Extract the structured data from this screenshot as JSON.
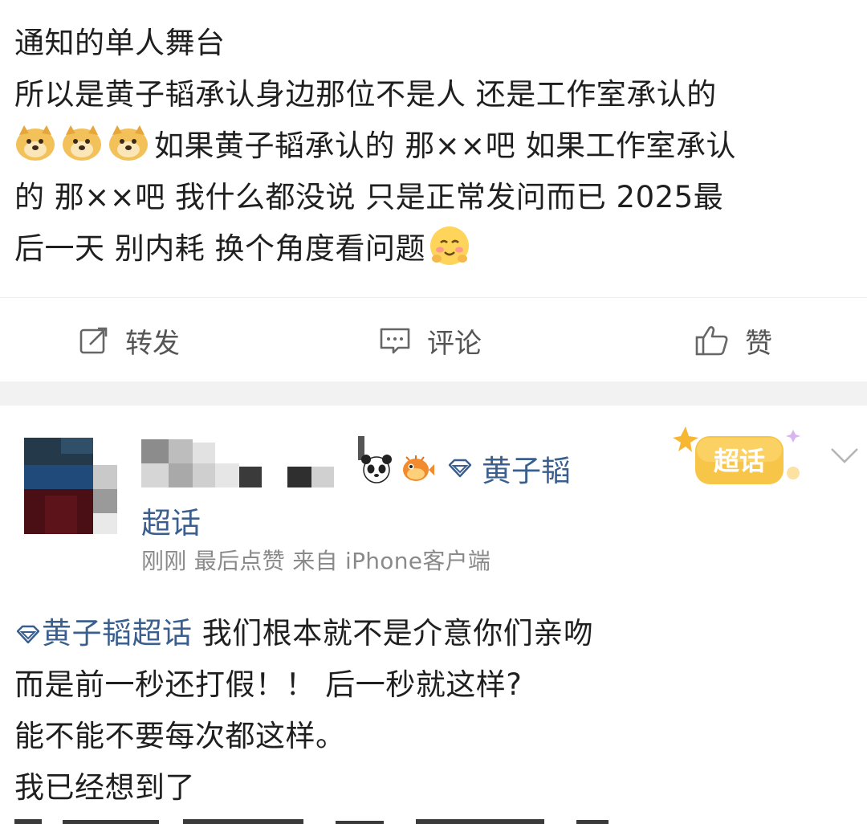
{
  "post1": {
    "lines": [
      "通知的单人舞台",
      "所以是黄子韬承认身边那位不是人 还是工作室承认的",
      "如果黄子韬承认的 那××吧 如果工作室承认",
      "的 那××吧 我什么都没说 只是正常发问而已 2025最",
      "后一天 别内耗 换个角度看问题"
    ],
    "emoji_dog": "doge-emoji",
    "emoji_blush": "blush-emoji"
  },
  "actions": {
    "repost": "转发",
    "comment": "评论",
    "like": "赞"
  },
  "post2": {
    "topic_name": "黄子韬",
    "topic_suffix": "超话",
    "badge_text": "超话",
    "meta": "刚刚 最后点赞  来自 iPhone客户端",
    "topic_inline": "黄子韬超话",
    "lines": [
      " 我们根本就不是介意你们亲吻",
      "而是前一秒还打假！！ 后一秒就这样?",
      "能不能不要每次都这样。",
      "我已经想到了"
    ]
  },
  "colors": {
    "link": "#3a5f8f",
    "meta": "#8a8a8a",
    "band": "#f2f2f2",
    "badge": "#f7c548"
  }
}
